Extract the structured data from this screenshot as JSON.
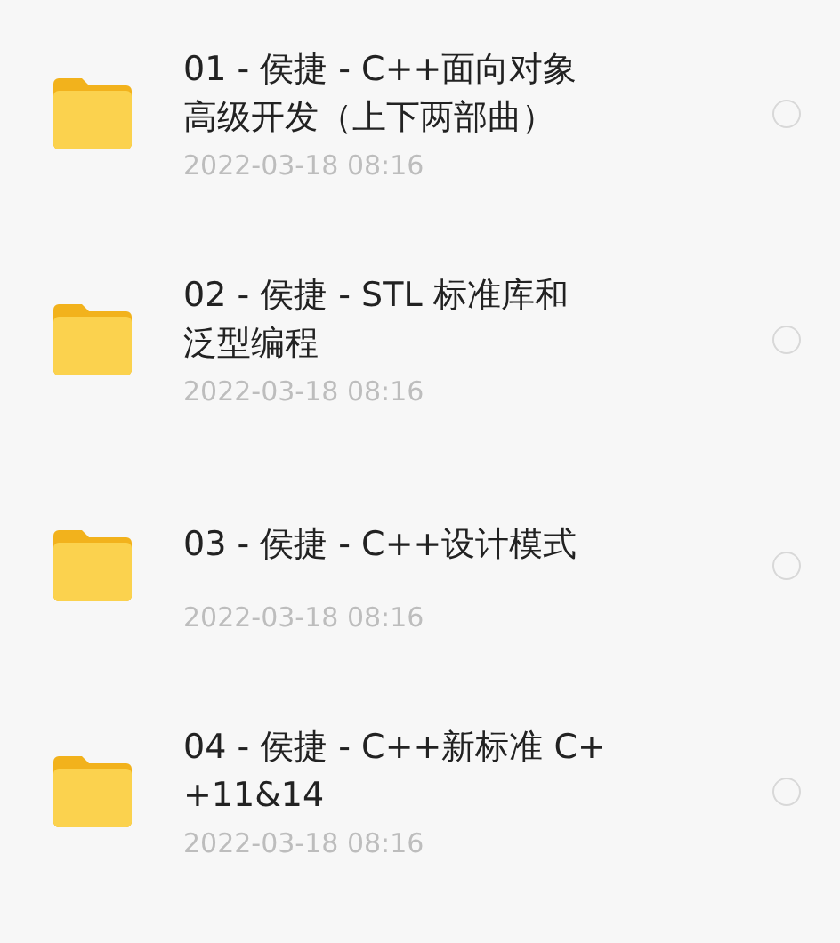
{
  "folders": [
    {
      "title_lines": [
        "01 - 侯捷 - C++面向对象",
        "高级开发（上下两部曲）"
      ],
      "date": "2022-03-18 08:16",
      "selected": false
    },
    {
      "title_lines": [
        "02 - 侯捷 - STL 标准库和",
        "泛型编程"
      ],
      "date": "2022-03-18 08:16",
      "selected": false
    },
    {
      "title_lines": [
        "03 - 侯捷 -  C++设计模式"
      ],
      "date": "2022-03-18 08:16",
      "selected": false
    },
    {
      "title_lines": [
        "04 - 侯捷 - C++新标准 C+",
        "+11&14"
      ],
      "date": "2022-03-18 08:16",
      "selected": false
    }
  ]
}
